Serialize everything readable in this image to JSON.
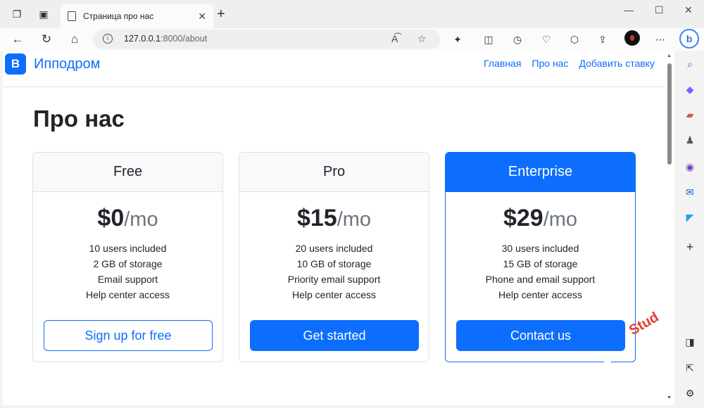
{
  "browser": {
    "tab": {
      "title": "Страница про нас"
    },
    "address": {
      "host": "127.0.0.1",
      "path": ":8000/about"
    }
  },
  "site": {
    "brand_logo": "B",
    "brand_name": "Ипподром",
    "nav": [
      {
        "label": "Главная"
      },
      {
        "label": "Про нас"
      },
      {
        "label": "Добавить ставку"
      }
    ]
  },
  "page": {
    "title": "Про нас",
    "plans": [
      {
        "name": "Free",
        "price": "$0",
        "per": "/mo",
        "features": [
          "10 users included",
          "2 GB of storage",
          "Email support",
          "Help center access"
        ],
        "button": "Sign up for free"
      },
      {
        "name": "Pro",
        "price": "$15",
        "per": "/mo",
        "features": [
          "20 users included",
          "10 GB of storage",
          "Priority email support",
          "Help center access"
        ],
        "button": "Get started"
      },
      {
        "name": "Enterprise",
        "price": "$29",
        "per": "/mo",
        "features": [
          "30 users included",
          "15 GB of storage",
          "Phone and email support",
          "Help center access"
        ],
        "button": "Contact us"
      }
    ]
  },
  "watermark": "Stud",
  "colors": {
    "primary": "#0d6efd",
    "watermark": "#e63b2e"
  },
  "icons": [
    "workspaces-icon",
    "tab-actions-icon",
    "page-icon",
    "close-icon",
    "plus-icon",
    "minimize-icon",
    "maximize-icon",
    "window-close-icon",
    "back-icon",
    "refresh-icon",
    "home-icon",
    "info-icon",
    "read-aloud-icon",
    "favorite-star-icon",
    "extensions-icon",
    "split-screen-icon",
    "history-icon",
    "performance-icon",
    "browser-essentials-icon",
    "share-icon",
    "profile-avatar",
    "more-icon",
    "copilot-icon",
    "search-icon",
    "shopping-icon",
    "tools-icon",
    "games-icon",
    "office-icon",
    "outlook-icon",
    "designer-icon",
    "sidebar-add-icon",
    "sidebar-toggle-icon",
    "open-external-icon",
    "settings-icon"
  ]
}
